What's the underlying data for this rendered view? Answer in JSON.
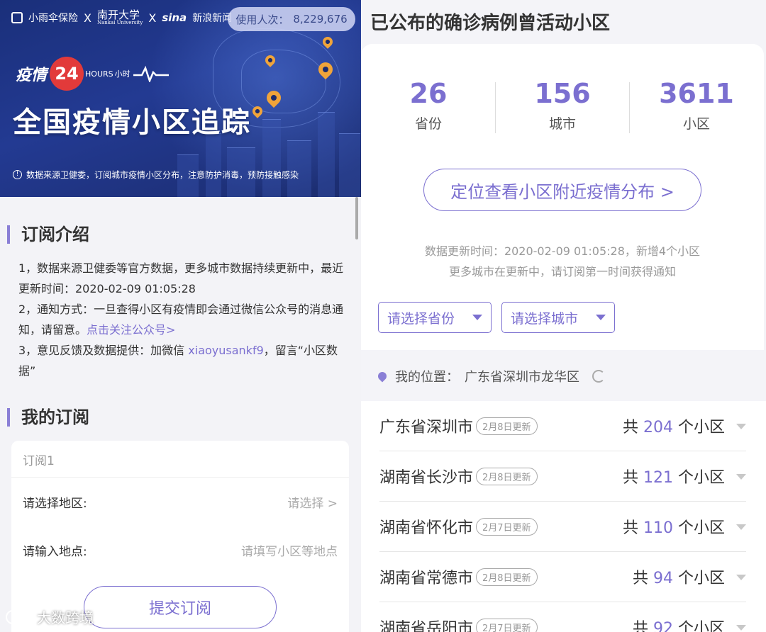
{
  "banner": {
    "partners": {
      "p1": "小雨伞保险",
      "x": "X",
      "p2": "南开大学",
      "p2_en": "Nankai University",
      "x2": "X",
      "p3_sina": "sina",
      "p3": "新浪新闻"
    },
    "users_label": "使用人次：",
    "users_count": "8,229,676",
    "brand_prefix": "疫情",
    "brand_num": "24",
    "brand_hours": "HOURS",
    "brand_suffix": "小时",
    "title": "全国疫情小区追踪",
    "note": "数据来源卫健委，订阅城市疫情小区分布，注意防护消毒，预防接触感染"
  },
  "intro": {
    "title": "订阅介绍",
    "line1": "1，数据来源卫健委等官方数据，更多城市数据持续更新中，最近更新时间：2020-02-09 01:05:28",
    "line2a": "2，通知方式：一旦查得小区有疫情即会通过微信公众号的消息通知，请留意。",
    "line2_link": "点击关注公众号>",
    "line3a": "3，意见反馈及数据提供：加微信 ",
    "line3_wechat": "xiaoyusankf9",
    "line3b": "，留言“小区数据”"
  },
  "subscription": {
    "title": "我的订阅",
    "card_header": "订阅1",
    "region_label": "请选择地区:",
    "region_value": "请选择 >",
    "place_label": "请输入地点:",
    "place_placeholder": "请填写小区等地点",
    "submit": "提交订阅"
  },
  "watermark": "大数跨境",
  "right": {
    "title": "已公布的确诊病例曾活动小区",
    "stats": [
      {
        "num": "26",
        "label": "省份"
      },
      {
        "num": "156",
        "label": "城市"
      },
      {
        "num": "3611",
        "label": "小区"
      }
    ],
    "locate_button": "定位查看小区附近疫情分布 >",
    "update_line1": "数据更新时间：2020-02-09 01:05:28，新增4个小区",
    "update_line2": "更多城市在更新中，请订阅第一时间获得通知",
    "select_province": "请选择省份",
    "select_city": "请选择城市",
    "location_label": "我的位置：",
    "location_value": "广东省深圳市龙华区"
  },
  "cities": [
    {
      "name": "广东省深圳市",
      "badge": "2月8日更新",
      "prefix": "共 ",
      "count": "204",
      "suffix": " 个小区"
    },
    {
      "name": "湖南省长沙市",
      "badge": "2月8日更新",
      "prefix": "共 ",
      "count": "121",
      "suffix": " 个小区"
    },
    {
      "name": "湖南省怀化市",
      "badge": "2月7日更新",
      "prefix": "共 ",
      "count": "110",
      "suffix": " 个小区"
    },
    {
      "name": "湖南省常德市",
      "badge": "2月8日更新",
      "prefix": "共 ",
      "count": "94",
      "suffix": " 个小区"
    },
    {
      "name": "湖南省岳阳市",
      "badge": "2月7日更新",
      "prefix": "共 ",
      "count": "92",
      "suffix": " 个小区"
    }
  ],
  "colors": {
    "accent": "#7b6fd0",
    "banner_bg": "#233a92",
    "pin": "#f0a43a"
  }
}
